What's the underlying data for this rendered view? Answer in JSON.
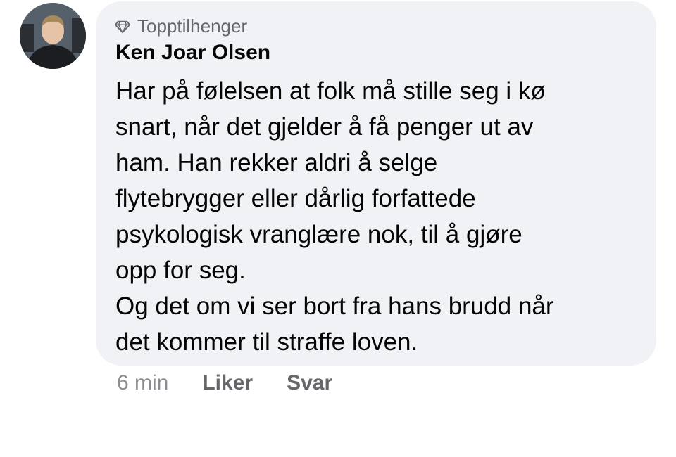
{
  "comment": {
    "badge": "Topptilhenger",
    "badge_icon": "diamond-icon",
    "author": "Ken Joar Olsen",
    "lines": [
      "Har på følelsen at folk må stille seg i kø",
      "snart, når det gjelder å få penger ut av",
      "ham. Han rekker aldri å selge",
      "flytebrygger eller dårlig forfattede",
      "psykologisk vranglære nok, til å gjøre",
      "opp for seg.",
      "Og det om vi ser bort fra hans brudd når",
      "det kommer til straffe loven."
    ],
    "time": "6 min",
    "like_label": "Liker",
    "reply_label": "Svar"
  },
  "colors": {
    "bubble_bg": "#f0f2f5",
    "text_primary": "#050505",
    "text_secondary": "#65676b"
  }
}
